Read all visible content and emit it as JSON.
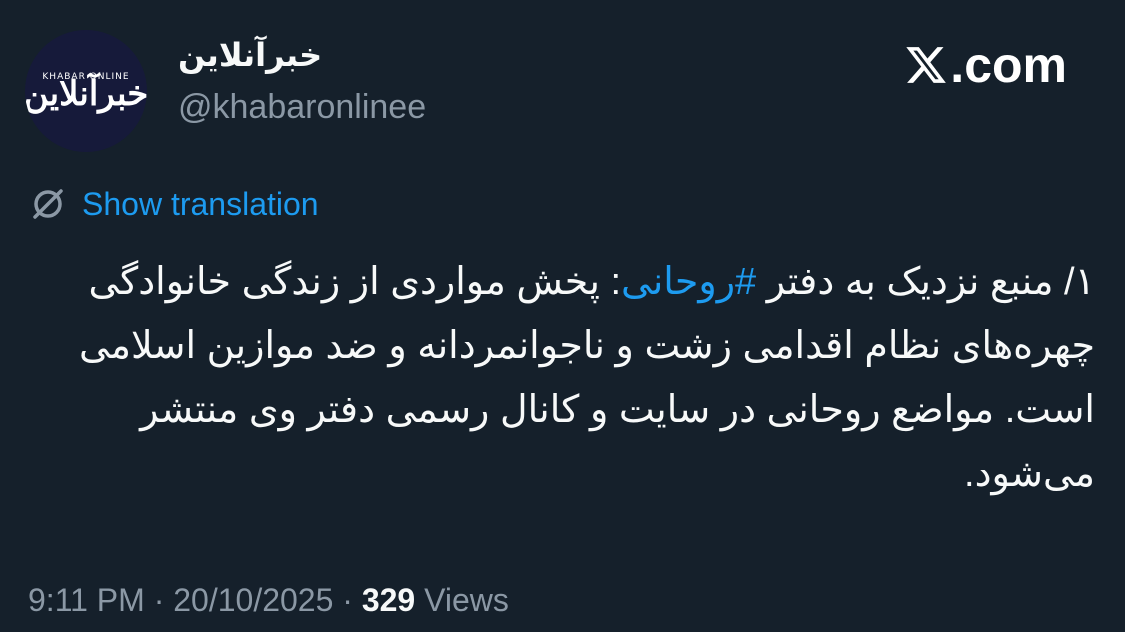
{
  "post": {
    "author": {
      "display_name": "خبرآنلاین",
      "handle": "@khabaronlinee",
      "avatar_logo": "خبرآنلاین",
      "avatar_logo_small": "KHABAR ONLINE"
    },
    "brand": {
      "label": ".com",
      "icon": "x-logo-icon"
    },
    "translation": {
      "label": "Show translation",
      "icon": "globe-icon"
    },
    "body": {
      "prefix": "۱/ منبع نزدیک به دفتر ",
      "hashtag": "#روحانی",
      "rest": ": پخش مواردی از زندگی خانوادگی چهره‌های نظام اقدامی زشت و ناجوانمردانه و ضد موازین اسلامی است. مواضع روحانی در سایت و کانال رسمی دفتر وی منتشر می‌شود."
    },
    "meta": {
      "time": "9:11 PM",
      "separator": " · ",
      "date": "20/10/2025",
      "views_count": "329",
      "views_label": " Views"
    }
  },
  "colors": {
    "background": "#15202b",
    "text": "#f7f9f9",
    "secondary": "#8b98a5",
    "accent": "#1d9bf0"
  }
}
